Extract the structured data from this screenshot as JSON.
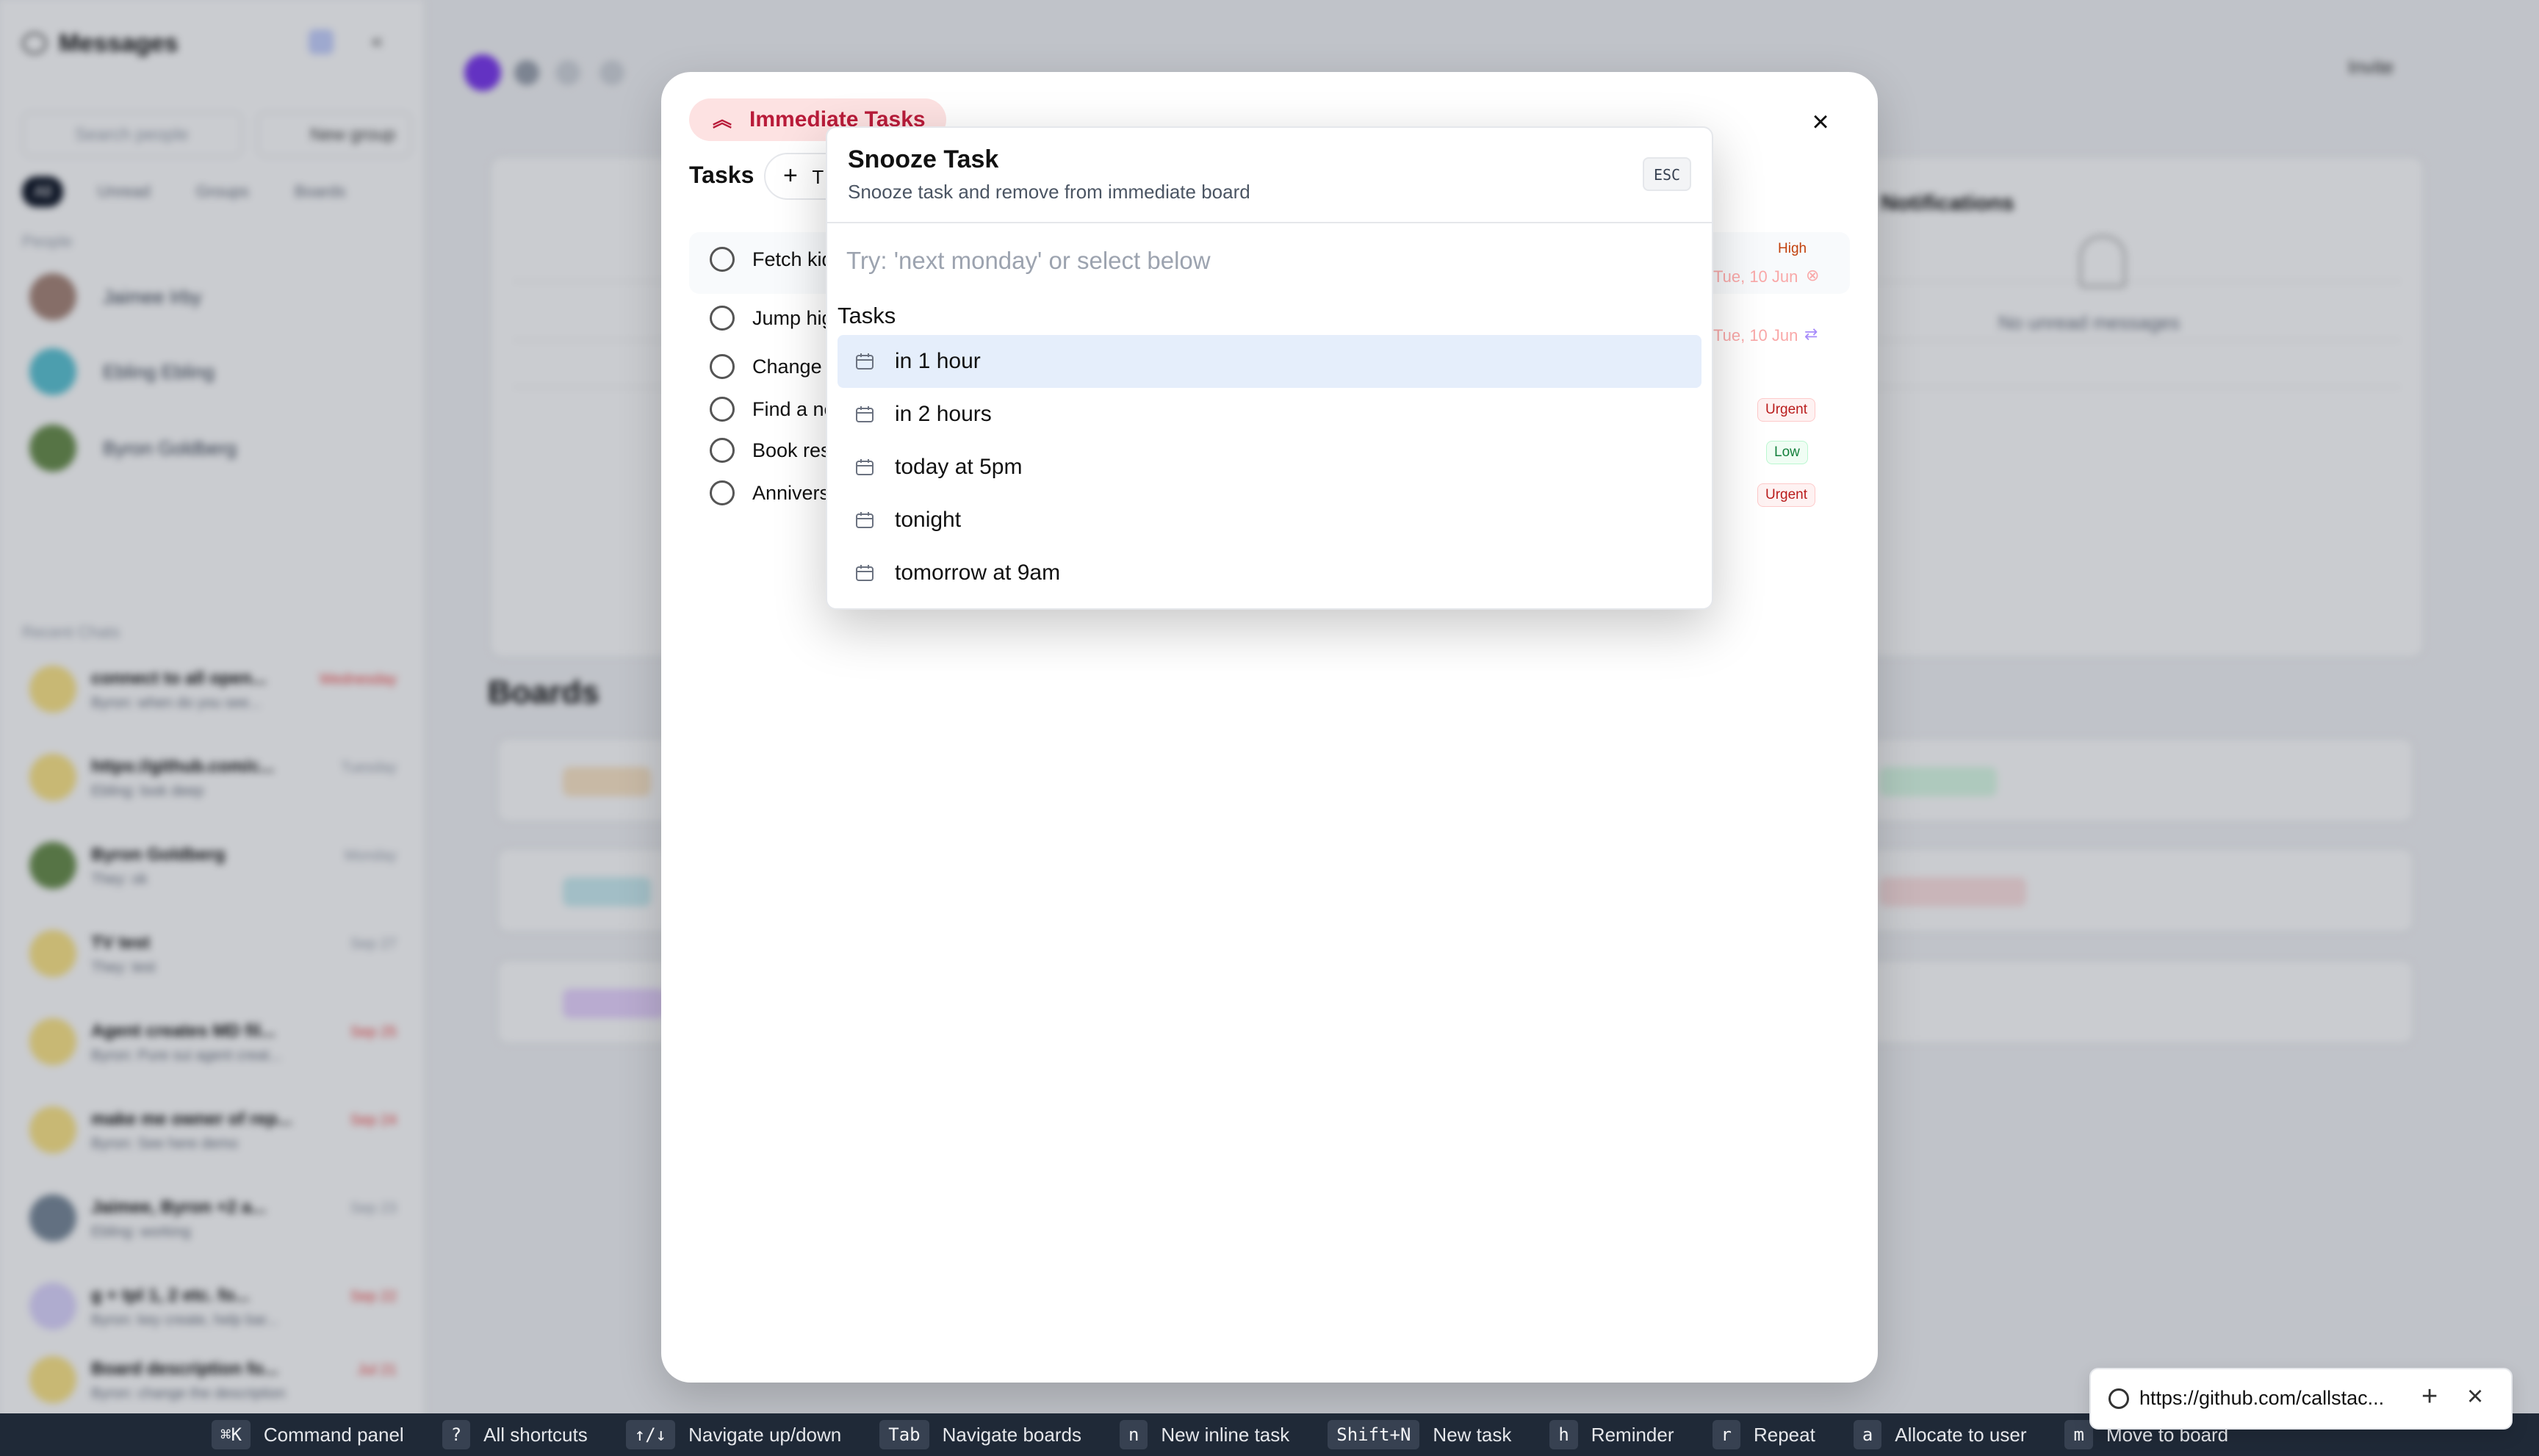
{
  "sidebar": {
    "title": "Messages",
    "search_placeholder": "Search people",
    "new_group": "New group",
    "filters": [
      "All",
      "Unread",
      "Groups",
      "Boards"
    ],
    "people_label": "People",
    "people": [
      "Jaimee Irby",
      "Ebling Ebling",
      "Byron Goldberg"
    ],
    "recent_label": "Recent Chats",
    "chats": [
      {
        "title": "connect to all open...",
        "sub": "Byron: when do you see...",
        "date": "Wednesday"
      },
      {
        "title": "https://github.com/c...",
        "sub": "Ebling: look deep",
        "date": "Tuesday"
      },
      {
        "title": "Byron Goldberg",
        "sub": "They: ok",
        "date": "Monday"
      },
      {
        "title": "TV test",
        "sub": "They: test",
        "date": "Sep 27"
      },
      {
        "title": "Agent creates MD fil...",
        "sub": "Byron: Pure sui agent creat...",
        "date": "Sep 25"
      },
      {
        "title": "make me owner of rep...",
        "sub": "Byron: See here demo",
        "date": "Sep 24"
      },
      {
        "title": "Jaimee, Byron +2 a...",
        "sub": "Ebling: working",
        "date": "Sep 23"
      },
      {
        "title": "g + tpl 1, 2 etc. fo...",
        "sub": "Byron: key create, help bar...",
        "date": "Sep 22"
      },
      {
        "title": "Board description fo...",
        "sub": "Byron: change the description",
        "date": "Jul 21"
      }
    ]
  },
  "background": {
    "boards_title": "Boards",
    "notifications_title": "Notifications",
    "no_unread": "No unread messages",
    "invite": "Invite"
  },
  "modal": {
    "board_name": "Immediate Tasks",
    "tasks_heading": "Tasks",
    "add_task_label": "T",
    "tasks": [
      {
        "text": "Fetch kid",
        "priority": "High",
        "due": "Tue, 10 Jun"
      },
      {
        "text": "Jump hig",
        "priority": "",
        "due": "Tue, 10 Jun"
      },
      {
        "text": "Change fo",
        "priority": "Urgent",
        "due": ""
      },
      {
        "text": "Find a ne",
        "priority": "Low",
        "due": ""
      },
      {
        "text": "Book rest",
        "priority": "Urgent",
        "due": ""
      },
      {
        "text": "Anniversa",
        "priority": "",
        "due": ""
      }
    ]
  },
  "snooze": {
    "title": "Snooze Task",
    "subtitle": "Snooze task and remove from immediate board",
    "esc": "ESC",
    "placeholder": "Try: 'next monday' or select below",
    "group_label": "Tasks",
    "options": [
      "in 1 hour",
      "in 2 hours",
      "today at 5pm",
      "tonight",
      "tomorrow at 9am"
    ],
    "selected_index": 0
  },
  "shortcuts": [
    {
      "key": "⌘K",
      "label": "Command panel"
    },
    {
      "key": "?",
      "label": "All shortcuts"
    },
    {
      "key": "↑/↓",
      "label": "Navigate up/down"
    },
    {
      "key": "Tab",
      "label": "Navigate boards"
    },
    {
      "key": "n",
      "label": "New inline task"
    },
    {
      "key": "Shift+N",
      "label": "New task"
    },
    {
      "key": "h",
      "label": "Reminder"
    },
    {
      "key": "r",
      "label": "Repeat"
    },
    {
      "key": "a",
      "label": "Allocate to user"
    },
    {
      "key": "m",
      "label": "Move to board"
    }
  ],
  "link_toast": {
    "url": "https://github.com/callstac..."
  },
  "colors": {
    "accent_red": "#b91c3a",
    "selected_option": "#e5eefb",
    "bottombar": "#1f2937"
  }
}
